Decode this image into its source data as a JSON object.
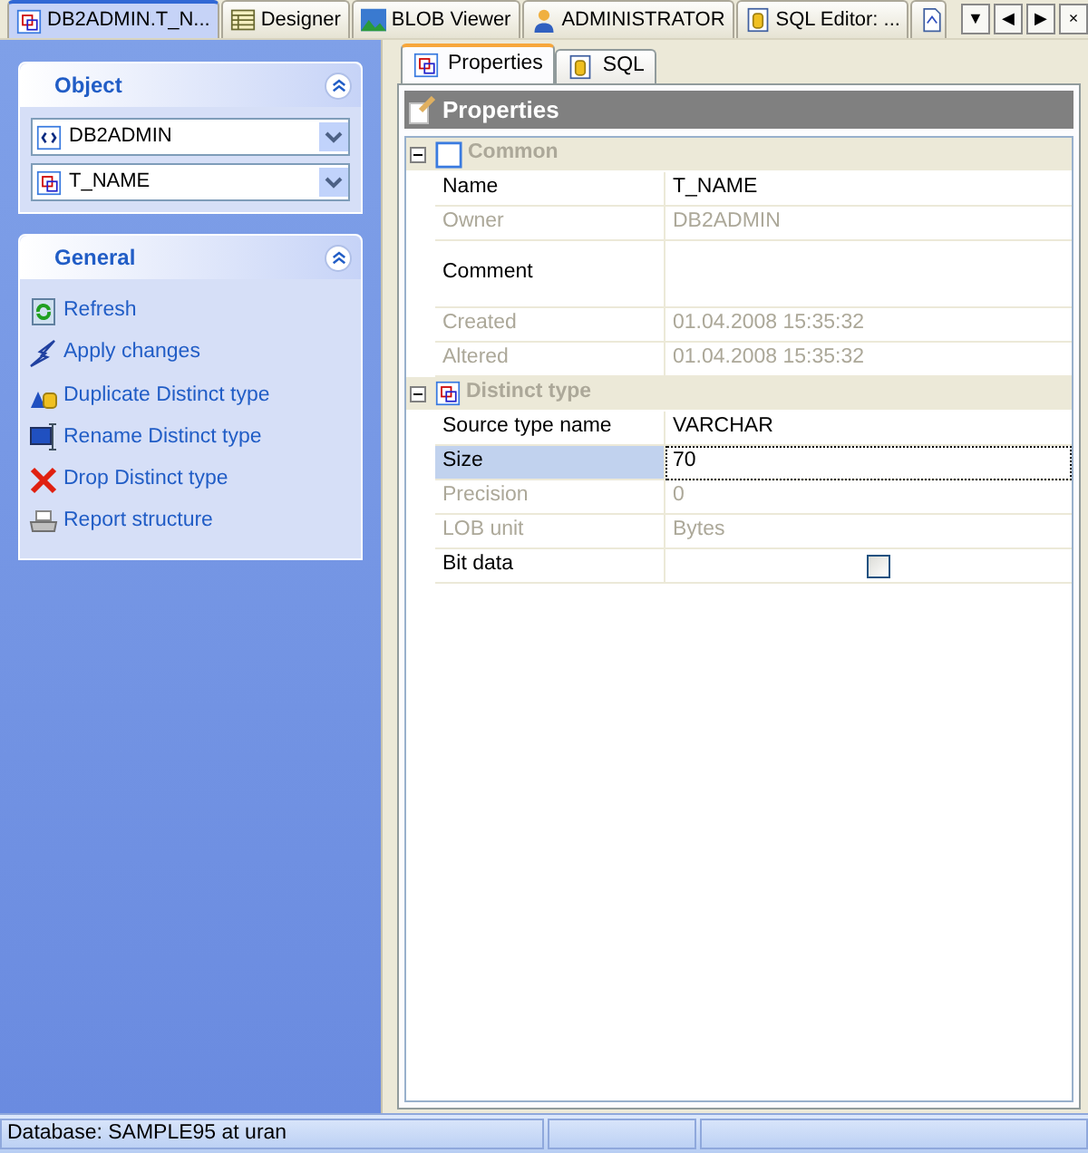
{
  "document_tabs": [
    {
      "label": "DB2ADMIN.T_N...",
      "selected": true
    },
    {
      "label": "Designer",
      "selected": false
    },
    {
      "label": "BLOB Viewer",
      "selected": false
    },
    {
      "label": "ADMINISTRATOR",
      "selected": false
    },
    {
      "label": "SQL Editor: ...",
      "selected": false
    },
    {
      "selected": false
    }
  ],
  "tab_controls": [
    "▼",
    "◀",
    "▶",
    "×"
  ],
  "sidebar": {
    "panels": [
      {
        "title": "Object",
        "expanded": true,
        "combos": [
          {
            "value": "DB2ADMIN"
          },
          {
            "value": "T_NAME"
          }
        ]
      },
      {
        "title": "General",
        "expanded": true,
        "actions": [
          {
            "label": "Refresh"
          },
          {
            "label": "Apply changes"
          },
          {
            "label": "Duplicate Distinct type"
          },
          {
            "label": "Rename Distinct type"
          },
          {
            "label": "Drop Distinct type"
          },
          {
            "label": "Report structure"
          }
        ]
      }
    ]
  },
  "editor_tabs": [
    {
      "label": "Properties",
      "selected": true
    },
    {
      "label": "SQL",
      "selected": false
    }
  ],
  "properties": {
    "title": "Properties",
    "groups": [
      {
        "title": "Common",
        "expanded": true,
        "rows": [
          {
            "kind": "text",
            "label": "Name",
            "value": "T_NAME",
            "disabled": false,
            "selected": false
          },
          {
            "kind": "text",
            "label": "Owner",
            "value": "DB2ADMIN",
            "disabled": true,
            "selected": false
          },
          {
            "kind": "memo",
            "label": "Comment",
            "value": "",
            "disabled": false,
            "selected": false
          },
          {
            "kind": "text",
            "label": "Created",
            "value": "01.04.2008 15:35:32",
            "disabled": true,
            "selected": false
          },
          {
            "kind": "text",
            "label": "Altered",
            "value": "01.04.2008 15:35:32",
            "disabled": true,
            "selected": false
          }
        ]
      },
      {
        "title": "Distinct type",
        "expanded": true,
        "rows": [
          {
            "kind": "text",
            "label": "Source type name",
            "value": "VARCHAR",
            "disabled": false,
            "selected": false
          },
          {
            "kind": "text",
            "label": "Size",
            "value": "70",
            "disabled": false,
            "selected": true
          },
          {
            "kind": "text",
            "label": "Precision",
            "value": "0",
            "disabled": true,
            "selected": false
          },
          {
            "kind": "text",
            "label": "LOB unit",
            "value": "Bytes",
            "disabled": true,
            "selected": false
          },
          {
            "kind": "checkbox",
            "label": "Bit data",
            "checked": false,
            "disabled": false,
            "selected": false
          }
        ]
      }
    ]
  },
  "status_bar": [
    "Database: SAMPLE95 at uran"
  ]
}
